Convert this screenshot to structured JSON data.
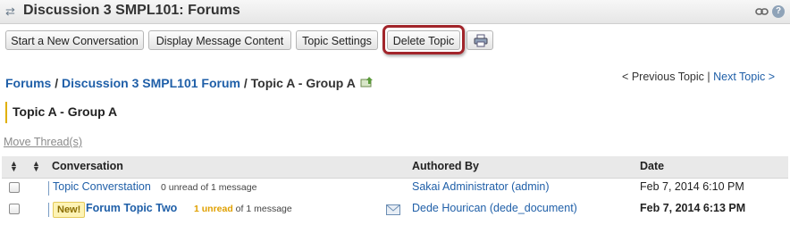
{
  "window": {
    "title": "Discussion 3 SMPL101: Forums"
  },
  "toolbar": {
    "buttons": [
      "Start a New Conversation",
      "Display Message Content",
      "Topic Settings",
      "Delete Topic"
    ],
    "print_icon": "printer-icon",
    "highlight_color": "#a2252b"
  },
  "breadcrumb": {
    "forums": "Forums",
    "sep1": " / ",
    "forum": "Discussion 3 SMPL101 Forum",
    "sep2": " / ",
    "topic": "Topic A - Group A"
  },
  "topic_nav": {
    "previous": "< Previous Topic",
    "divider": " | ",
    "next": "Next Topic >"
  },
  "topic_heading": "Topic A - Group A",
  "move_threads": "Move Thread(s)",
  "table": {
    "headers": {
      "conversation": "Conversation",
      "authored_by": "Authored By",
      "date": "Date"
    },
    "rows": [
      {
        "title": "Topic Converstation",
        "unread": "0 unread",
        "of": " of 1 message",
        "author": "Sakai Administrator (admin)",
        "date": "Feb 7, 2014 6:10 PM"
      },
      {
        "badge": "New!",
        "title": "Forum Topic Two",
        "unread": "1 unread",
        "of": " of 1 message",
        "author": "Dede Hourican (dede_document)",
        "date": "Feb 7, 2014 6:13 PM"
      }
    ]
  },
  "colors": {
    "link": "#1f5fa8",
    "unread_accent": "#e0a000"
  }
}
